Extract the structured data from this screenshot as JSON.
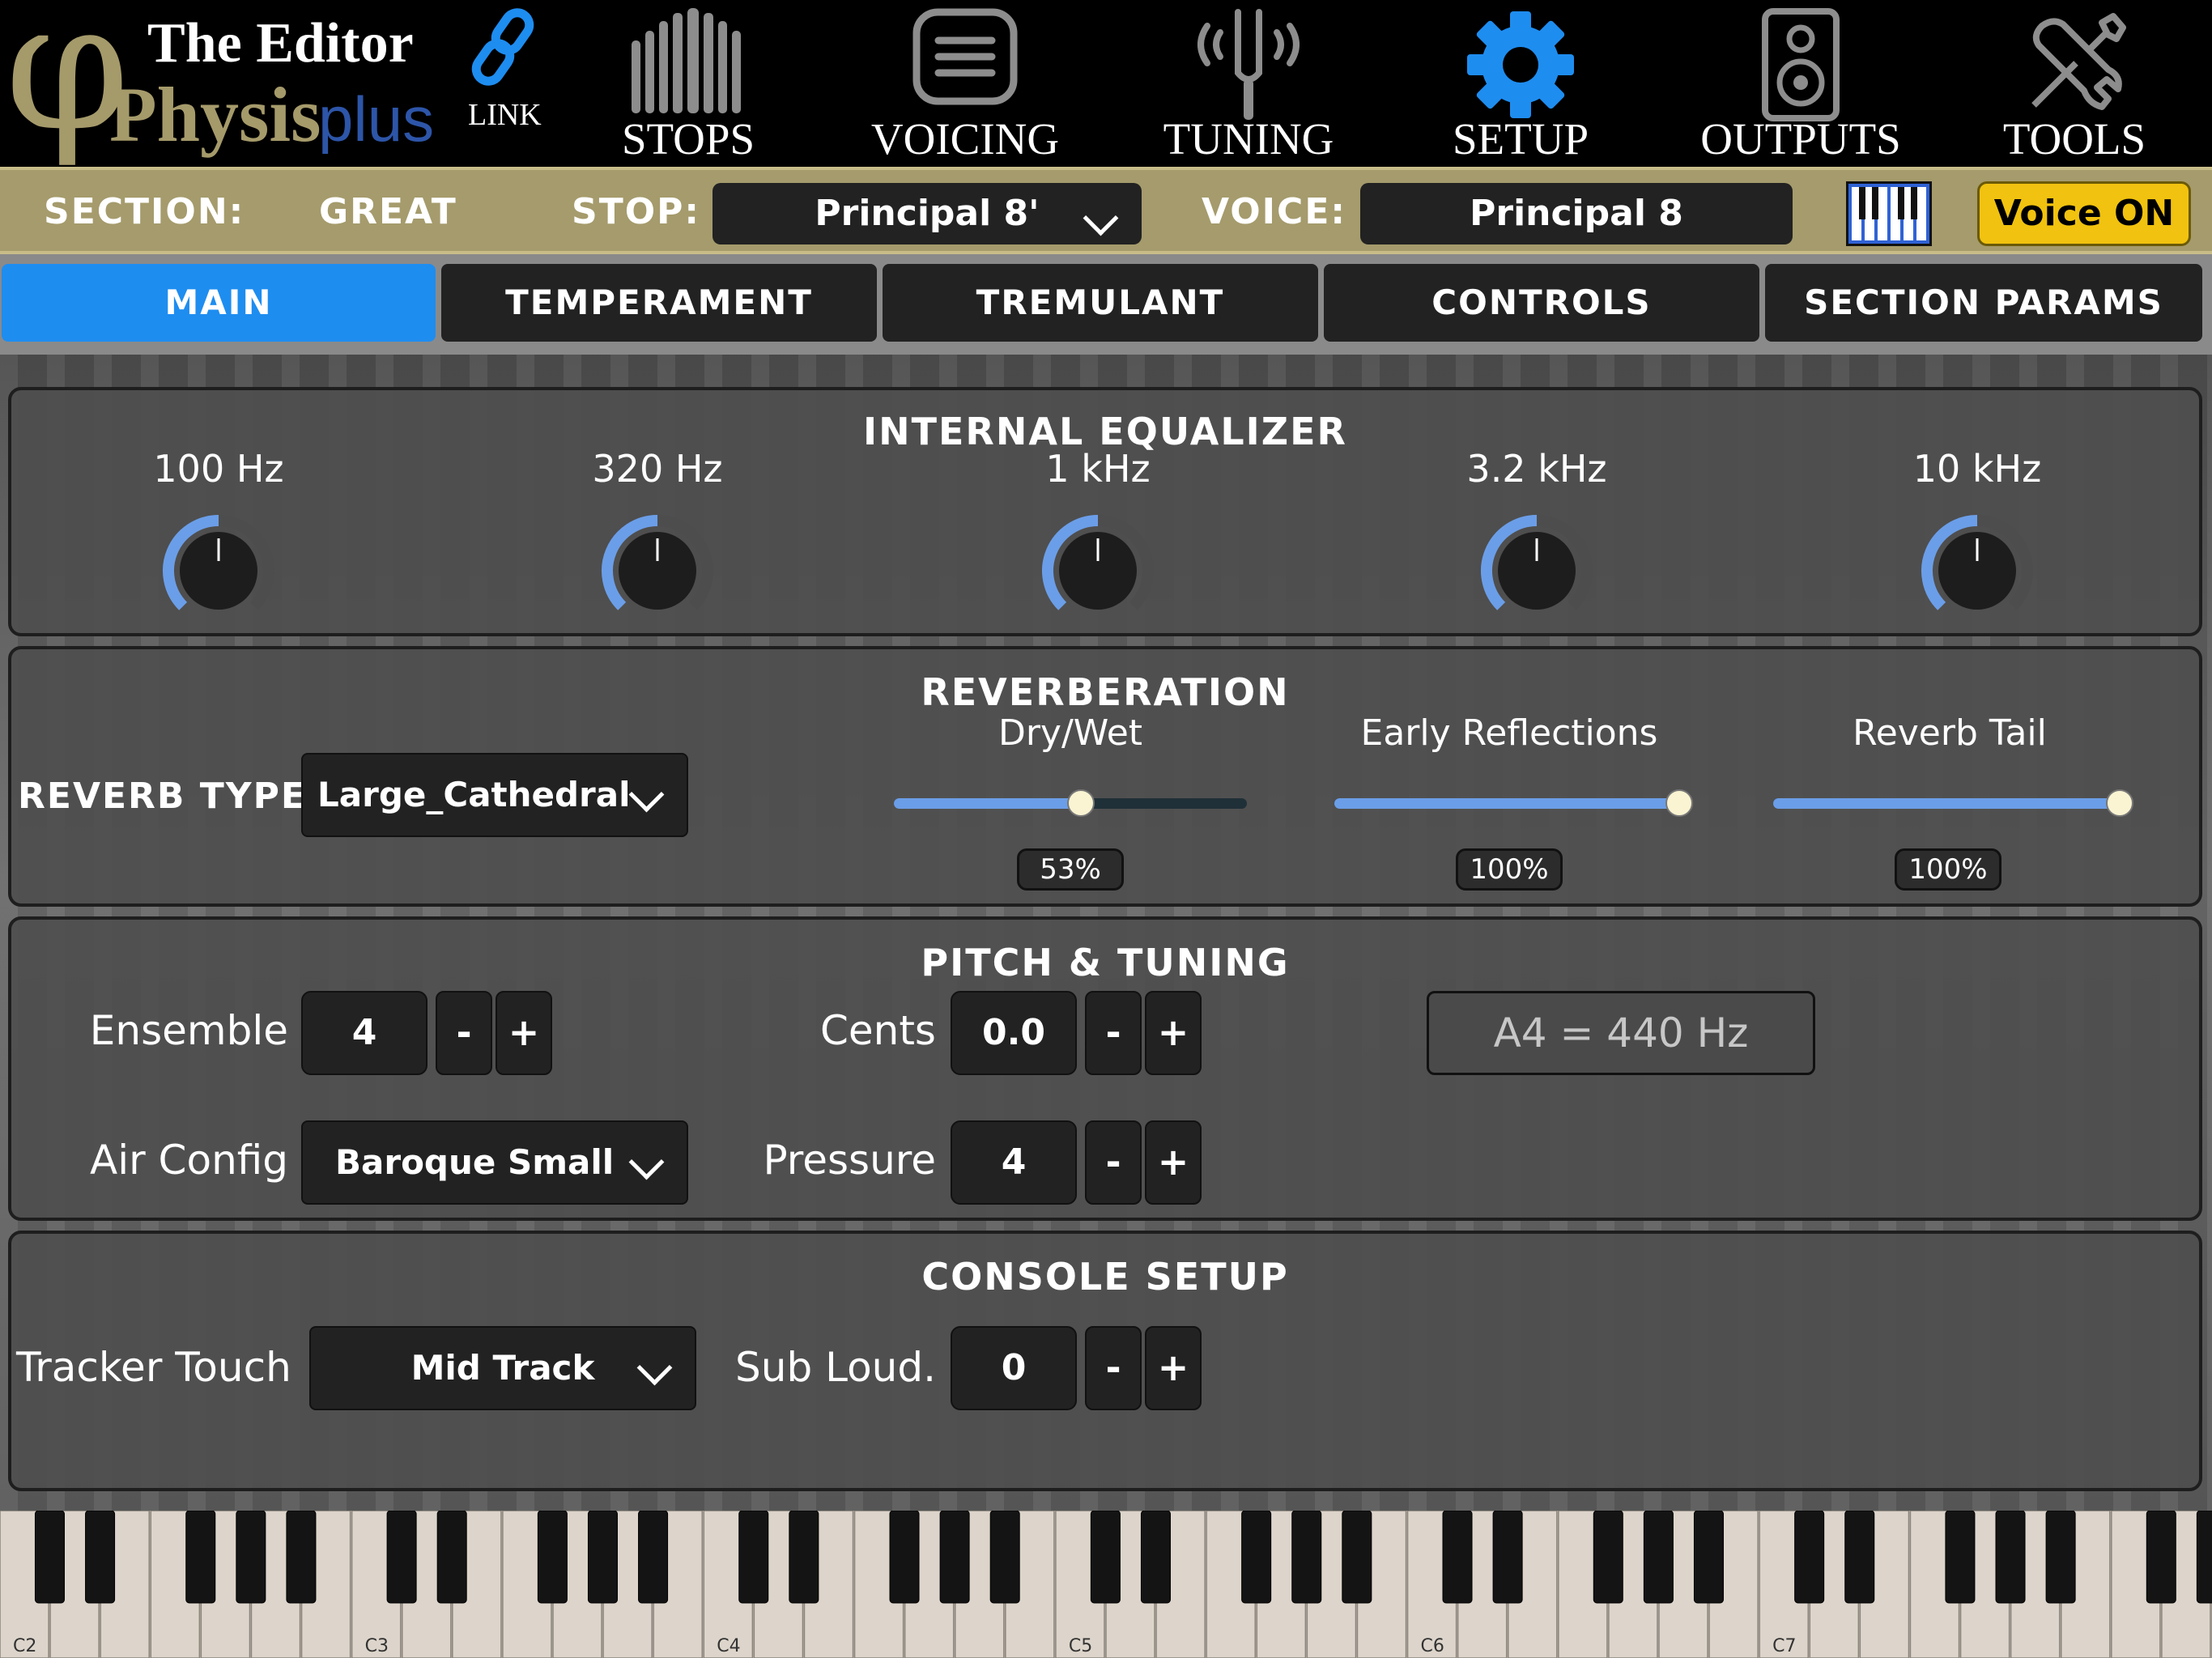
{
  "logo": {
    "top_text": "The Editor",
    "brand_main": "Physis",
    "brand_suffix": "plus"
  },
  "nav": {
    "link_label": "LINK",
    "items": [
      {
        "label": "STOPS",
        "icon": "organ-pipes-icon",
        "active": false
      },
      {
        "label": "VOICING",
        "icon": "voicing-icon",
        "active": false
      },
      {
        "label": "TUNING",
        "icon": "tuning-fork-icon",
        "active": false
      },
      {
        "label": "SETUP",
        "icon": "gear-icon",
        "active": true
      },
      {
        "label": "OUTPUTS",
        "icon": "speaker-icon",
        "active": false
      },
      {
        "label": "TOOLS",
        "icon": "tools-icon",
        "active": false
      }
    ]
  },
  "section_bar": {
    "section_label": "SECTION:",
    "section_value": "GREAT",
    "stop_label": "STOP:",
    "stop_value": "Principal 8'",
    "voice_label": "VOICE:",
    "voice_value": "Principal 8",
    "voice_on_label": "Voice ON"
  },
  "tabs": [
    {
      "label": "MAIN",
      "active": true
    },
    {
      "label": "TEMPERAMENT",
      "active": false
    },
    {
      "label": "TREMULANT",
      "active": false
    },
    {
      "label": "CONTROLS",
      "active": false
    },
    {
      "label": "SECTION PARAMS",
      "active": false
    }
  ],
  "equalizer": {
    "title": "INTERNAL EQUALIZER",
    "bands": [
      {
        "freq": "100 Hz",
        "level": 0.5
      },
      {
        "freq": "320 Hz",
        "level": 0.5
      },
      {
        "freq": "1 kHz",
        "level": 0.5
      },
      {
        "freq": "3.2 kHz",
        "level": 0.5
      },
      {
        "freq": "10 kHz",
        "level": 0.5
      }
    ]
  },
  "reverb": {
    "title": "REVERBERATION",
    "type_label": "REVERB TYPE",
    "type_value": "Large_Cathedral",
    "sliders": [
      {
        "label": "Dry/Wet",
        "value": 53,
        "display": "53%"
      },
      {
        "label": "Early Reflections",
        "value": 100,
        "display": "100%"
      },
      {
        "label": "Reverb Tail",
        "value": 100,
        "display": "100%"
      }
    ]
  },
  "pitch": {
    "title": "PITCH & TUNING",
    "ensemble_label": "Ensemble",
    "ensemble_value": "4",
    "cents_label": "Cents",
    "cents_value": "0.0",
    "a4_text": "A4 = 440 Hz",
    "air_config_label": "Air Config",
    "air_config_value": "Baroque Small",
    "pressure_label": "Pressure",
    "pressure_value": "4",
    "minus": "-",
    "plus": "+"
  },
  "console": {
    "title": "CONSOLE SETUP",
    "tracker_label": "Tracker Touch",
    "tracker_value": "Mid Track",
    "sub_loud_label": "Sub Loud.",
    "sub_loud_value": "0"
  },
  "keyboard": {
    "octave_labels": [
      "C2",
      "C3",
      "C4",
      "C5",
      "C6",
      "C7"
    ]
  },
  "colors": {
    "accent": "#1e8df0",
    "gold": "#a59b6c",
    "voice_on": "#f1c20f",
    "knob_arc": "#6b9ee8"
  }
}
